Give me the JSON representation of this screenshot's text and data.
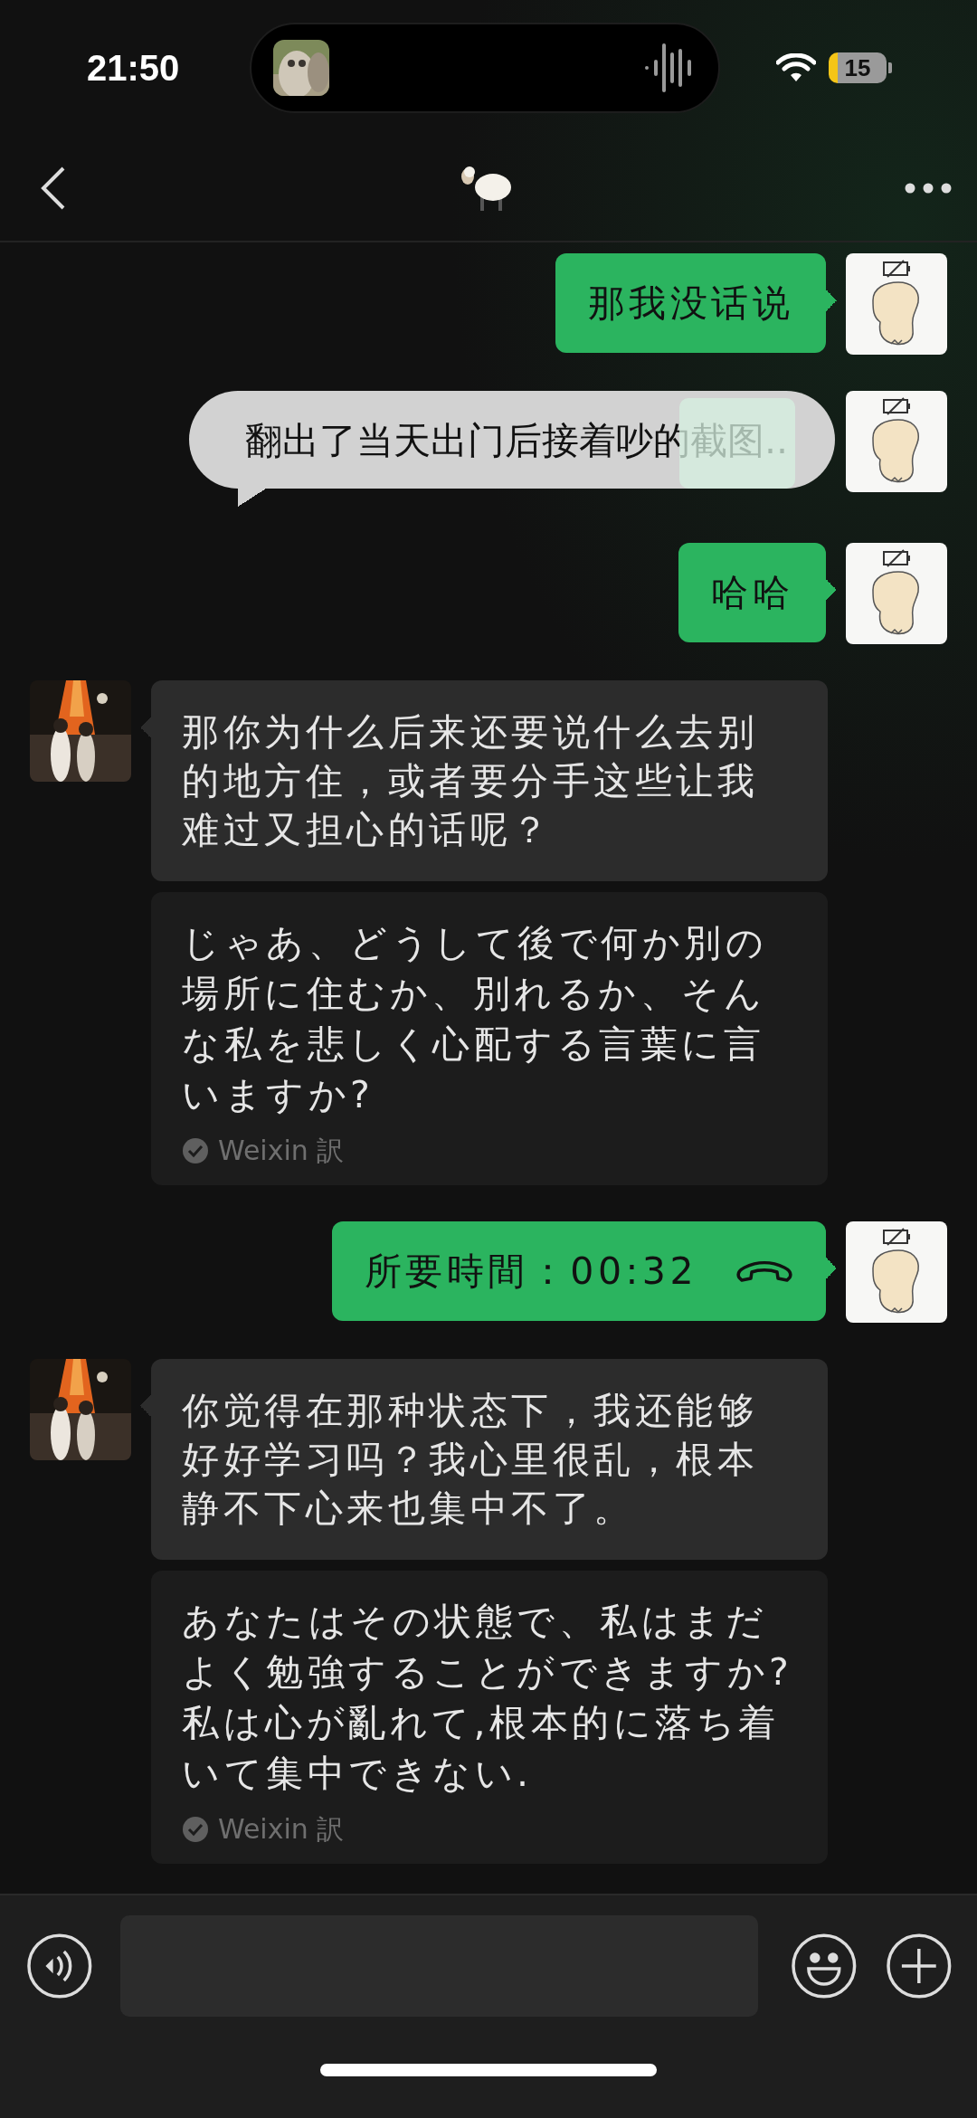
{
  "status_bar": {
    "time": "21:50",
    "battery": "15"
  },
  "messages": [
    {
      "outgoing": true,
      "kind": "text",
      "text": "那我没话说"
    },
    {
      "outgoing": true,
      "kind": "quote",
      "text": "翻出了当天出门后接着吵的截图.."
    },
    {
      "outgoing": true,
      "kind": "text",
      "text": "哈哈"
    },
    {
      "outgoing": false,
      "kind": "text",
      "text": "那你为什么后来还要说什么去别的地方住，或者要分手这些让我难过又担心的话呢？",
      "translation": {
        "text": "じゃあ、どうして後で何か別の場所に住むか、別れるか、そんな私を悲しく心配する言葉に言いますか?",
        "source": "Weixin 訳"
      }
    },
    {
      "outgoing": true,
      "kind": "call",
      "text": "所要時間：00:32"
    },
    {
      "outgoing": false,
      "kind": "text",
      "text": "你觉得在那种状态下，我还能够好好学习吗？我心里很乱，根本静不下心来也集中不了。",
      "translation": {
        "text": "あなたはその状態で、私はまだよく勉強することができますか?私は心が亂れて,根本的に落ち着いて集中できない.",
        "source": "Weixin 訳"
      }
    }
  ]
}
